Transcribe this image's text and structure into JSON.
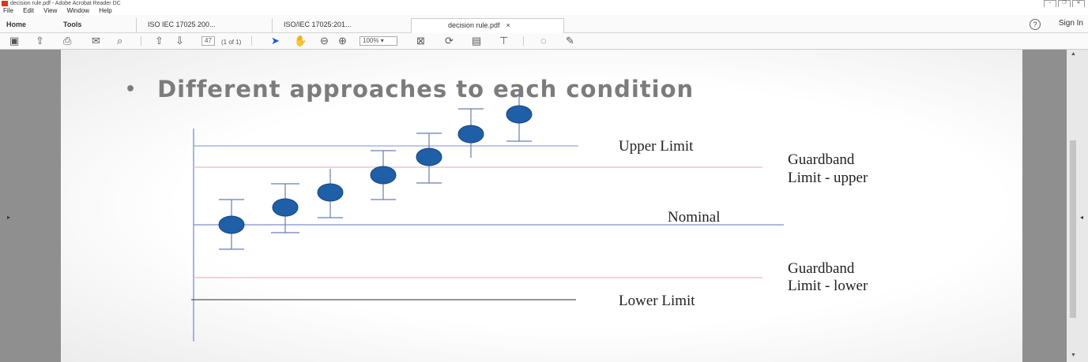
{
  "window": {
    "title": "decision rule.pdf - Adobe Acrobat Reader DC",
    "controls": [
      "–",
      "❐",
      "✕"
    ]
  },
  "menu": [
    "File",
    "Edit",
    "View",
    "Window",
    "Help"
  ],
  "tabs": {
    "home": "Home",
    "tools": "Tools",
    "doc1": "ISO IEC 17025 200...",
    "doc2": "ISO/IEC 17025:201...",
    "active": "decision rule.pdf",
    "close": "×",
    "help": "?",
    "signin": "Sign In"
  },
  "toolbar": {
    "page_current": "47",
    "page_total": "(1 of 1)",
    "zoom": "100%"
  },
  "slide": {
    "bullet": "•",
    "heading": "Different approaches to each condition",
    "labels": {
      "upper_limit": "Upper Limit",
      "guardband_upper_1": "Guardband",
      "guardband_upper_2": "Limit - upper",
      "nominal": "Nominal",
      "guardband_lower_1": "Guardband",
      "guardband_lower_2": "Limit - lower",
      "lower_limit": "Lower Limit"
    },
    "colors": {
      "point": "#1f5fa8",
      "axis": "#7f8fc8",
      "guardband": "#f0b8c0",
      "lower_line": "#555555"
    }
  }
}
